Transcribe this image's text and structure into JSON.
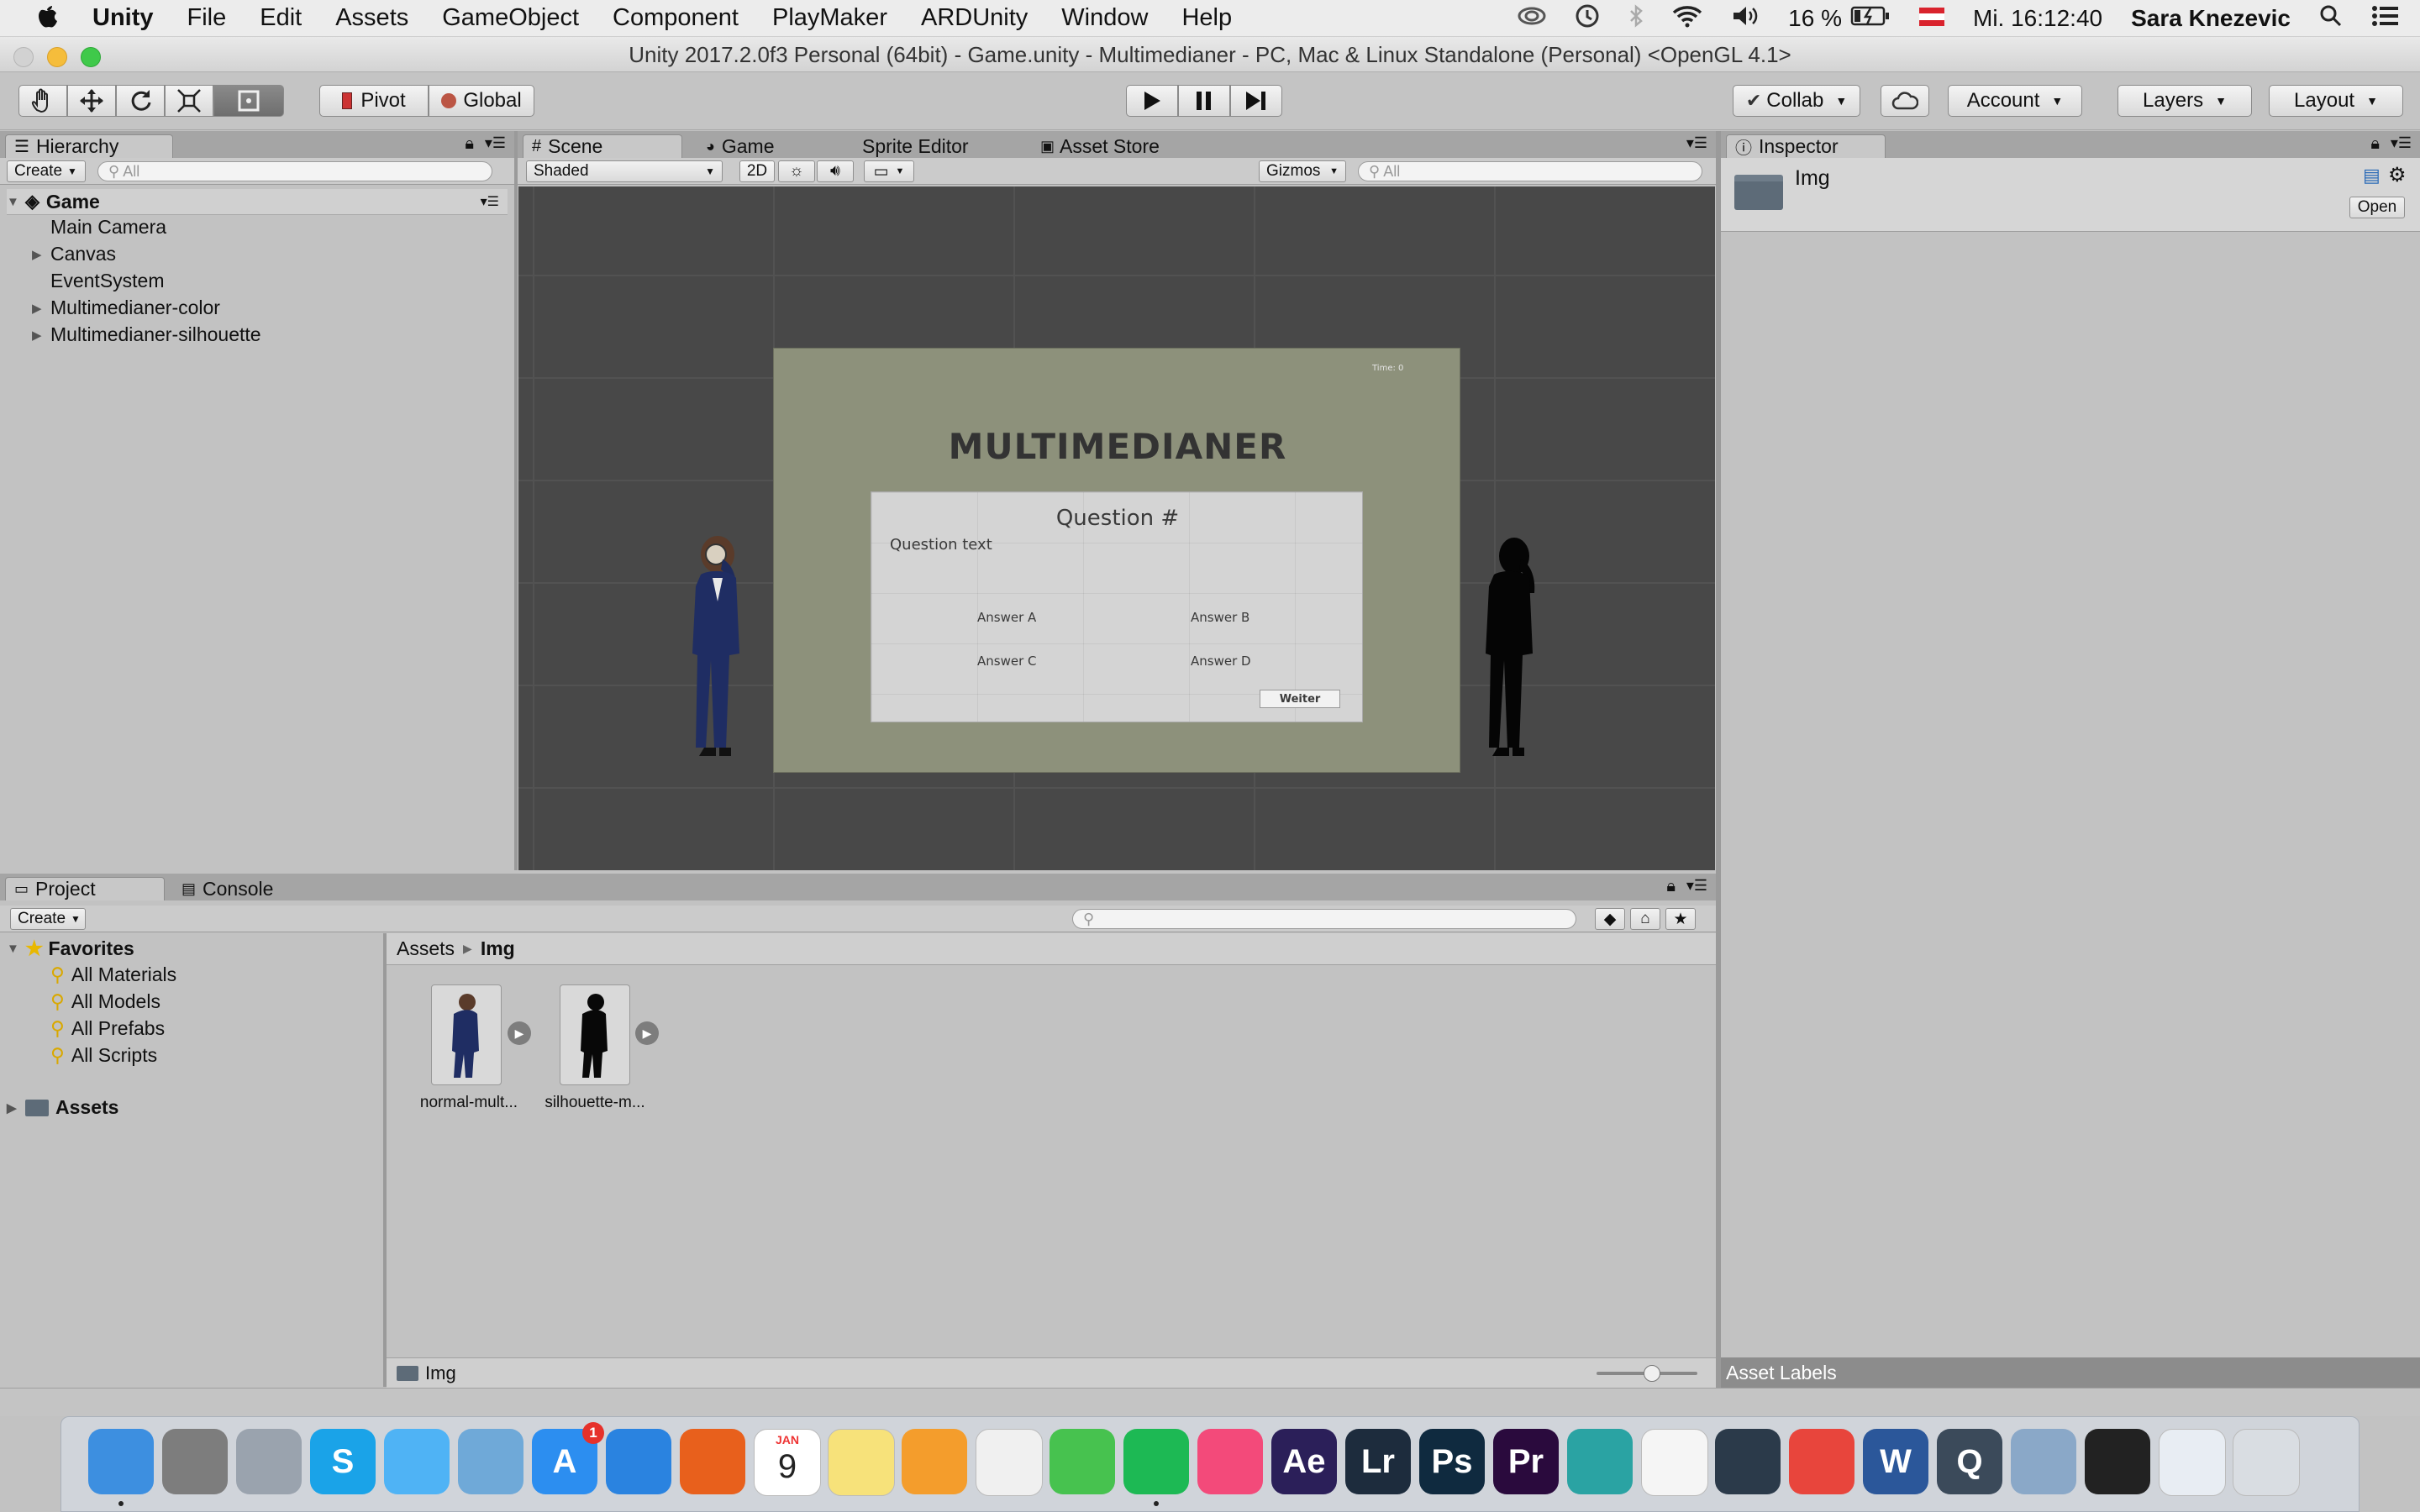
{
  "menubar": {
    "apple": "",
    "app_name": "Unity",
    "items": [
      "File",
      "Edit",
      "Assets",
      "GameObject",
      "Component",
      "PlayMaker",
      "ARDUnity",
      "Window",
      "Help"
    ],
    "battery": "16 %",
    "clock": "Mi. 16:12:40",
    "user": "Sara Knezevic"
  },
  "window": {
    "title": "Unity 2017.2.0f3 Personal (64bit) - Game.unity - Multimedianer - PC, Mac & Linux Standalone (Personal) <OpenGL 4.1>"
  },
  "toolbar": {
    "pivot": "Pivot",
    "global": "Global",
    "collab": "Collab",
    "account": "Account",
    "layers": "Layers",
    "layout": "Layout"
  },
  "hierarchy": {
    "tab": "Hierarchy",
    "create": "Create",
    "search_placeholder": "All",
    "scene": "Game",
    "items": [
      {
        "label": "Main Camera",
        "expandable": false
      },
      {
        "label": "Canvas",
        "expandable": true
      },
      {
        "label": "EventSystem",
        "expandable": false
      },
      {
        "label": "Multimedianer-color",
        "expandable": true
      },
      {
        "label": "Multimedianer-silhouette",
        "expandable": true
      }
    ]
  },
  "scene_panel": {
    "tabs": [
      "Scene",
      "Game",
      "Sprite Editor",
      "Asset Store"
    ],
    "shading": "Shaded",
    "mode_2d": "2D",
    "gizmos": "Gizmos",
    "search_placeholder": "All"
  },
  "game_ui": {
    "time": "Time: 0",
    "title": "MULTIMEDIANER",
    "question_title": "Question #",
    "question_text": "Question text",
    "answers": [
      "Answer A",
      "Answer B",
      "Answer C",
      "Answer D"
    ],
    "next_button": "Weiter"
  },
  "inspector": {
    "tab": "Inspector",
    "asset_name": "Img",
    "open_button": "Open",
    "asset_labels": "Asset Labels"
  },
  "project": {
    "tabs": [
      "Project",
      "Console"
    ],
    "create": "Create",
    "favorites_label": "Favorites",
    "favorites": [
      "All Materials",
      "All Models",
      "All Prefabs",
      "All Scripts"
    ],
    "assets_root": "Assets",
    "breadcrumb": [
      "Assets",
      "Img"
    ],
    "files": [
      "normal-mult...",
      "silhouette-m..."
    ],
    "footer_path": "Img"
  },
  "dock": {
    "calendar_month": "JAN",
    "calendar_day": "9",
    "badge_appstore": "1",
    "apps": [
      {
        "name": "finder",
        "label": "",
        "color": "#3d8fe0"
      },
      {
        "name": "system-preferences",
        "label": "",
        "color": "#7d7d7d"
      },
      {
        "name": "launchpad",
        "label": "",
        "color": "#9aa3ae"
      },
      {
        "name": "skype",
        "label": "S",
        "color": "#1aa3e8"
      },
      {
        "name": "messages",
        "label": "",
        "color": "#4fb3f5"
      },
      {
        "name": "preview-bird",
        "label": "",
        "color": "#6fa9d8"
      },
      {
        "name": "app-store",
        "label": "A",
        "color": "#2c8ef0"
      },
      {
        "name": "safari",
        "label": "",
        "color": "#2a83e0"
      },
      {
        "name": "firefox",
        "label": "",
        "color": "#e8601c"
      },
      {
        "name": "calendar",
        "label": "",
        "color": "#ffffff"
      },
      {
        "name": "notes",
        "label": "",
        "color": "#f7e27a"
      },
      {
        "name": "pages",
        "label": "",
        "color": "#f49d2c"
      },
      {
        "name": "photos",
        "label": "",
        "color": "#f0f0f0"
      },
      {
        "name": "facetime",
        "label": "",
        "color": "#47c24f"
      },
      {
        "name": "spotify",
        "label": "",
        "color": "#1db954"
      },
      {
        "name": "itunes",
        "label": "",
        "color": "#f34a7a"
      },
      {
        "name": "after-effects",
        "label": "Ae",
        "color": "#2b1f59"
      },
      {
        "name": "lightroom",
        "label": "Lr",
        "color": "#1d2c3d"
      },
      {
        "name": "photoshop",
        "label": "Ps",
        "color": "#0f2a3f"
      },
      {
        "name": "premiere",
        "label": "Pr",
        "color": "#2a0a3d"
      },
      {
        "name": "maya",
        "label": "",
        "color": "#2aa3a3"
      },
      {
        "name": "network-app",
        "label": "",
        "color": "#f5f5f5"
      },
      {
        "name": "brackets",
        "label": "",
        "color": "#2b3a4a"
      },
      {
        "name": "chrome",
        "label": "",
        "color": "#e8453c"
      },
      {
        "name": "word",
        "label": "W",
        "color": "#2b579a"
      },
      {
        "name": "quicktime",
        "label": "Q",
        "color": "#3b4a5a"
      },
      {
        "name": "photo-viewer",
        "label": "",
        "color": "#8aa8c8"
      },
      {
        "name": "unity",
        "label": "",
        "color": "#222222"
      },
      {
        "name": "word-document",
        "label": "",
        "color": "#e8edf3"
      },
      {
        "name": "trash",
        "label": "",
        "color": "#d9dde2"
      }
    ]
  }
}
